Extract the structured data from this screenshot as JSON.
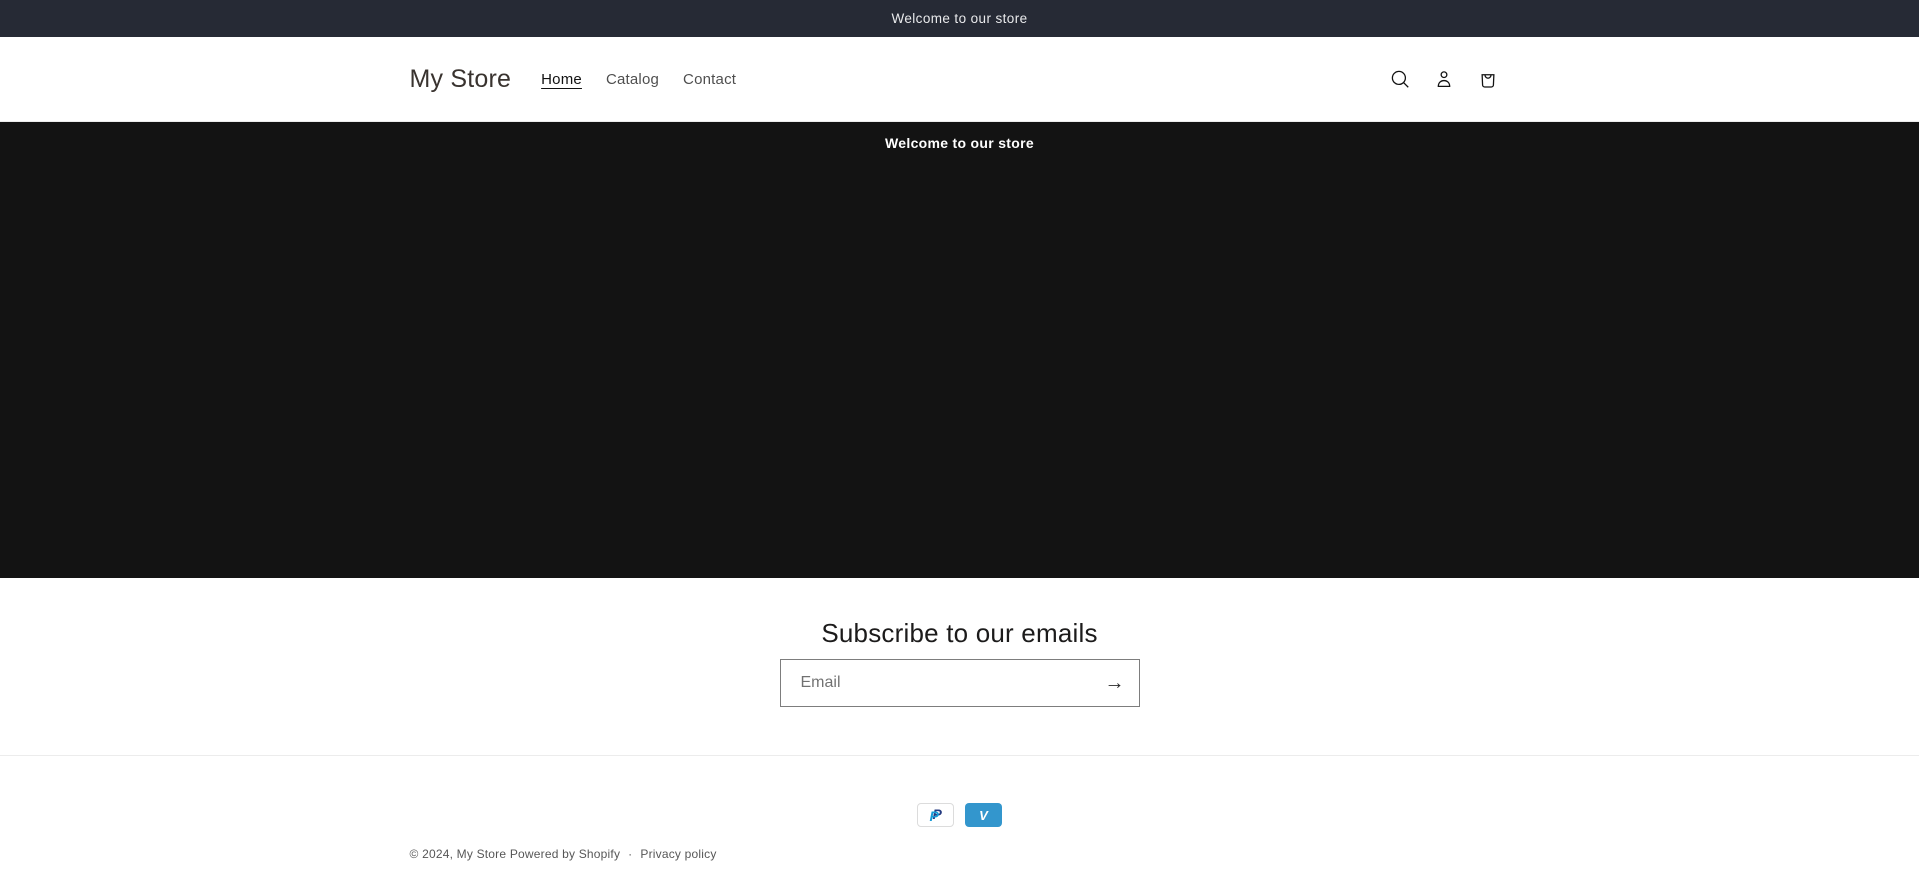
{
  "announcement": {
    "text": "Welcome to our store"
  },
  "header": {
    "store_name": "My Store",
    "nav": [
      {
        "label": "Home",
        "active": true
      },
      {
        "label": "Catalog",
        "active": false
      },
      {
        "label": "Contact",
        "active": false
      }
    ],
    "icons": [
      {
        "name": "search-icon"
      },
      {
        "name": "account-icon"
      },
      {
        "name": "cart-icon"
      }
    ]
  },
  "hero": {
    "heading": "Welcome to our store"
  },
  "newsletter": {
    "heading": "Subscribe to our emails",
    "email_placeholder": "Email",
    "email_value": "",
    "submit_icon": "arrow-right-icon",
    "submit_glyph": "→"
  },
  "footer": {
    "payment_methods": [
      {
        "name": "PayPal",
        "mark": "P"
      },
      {
        "name": "Venmo",
        "mark": "V"
      }
    ],
    "copyright": "© 2024, My Store",
    "powered_by": "Powered by Shopify",
    "separator": "·",
    "privacy_policy": "Privacy policy"
  },
  "colors": {
    "announcement_bg": "#262a35",
    "hero_bg": "#131313",
    "text_dark": "#121212",
    "venmo_blue": "#3396cd",
    "paypal_navy": "#253b80",
    "paypal_light_blue": "#179bd7"
  }
}
